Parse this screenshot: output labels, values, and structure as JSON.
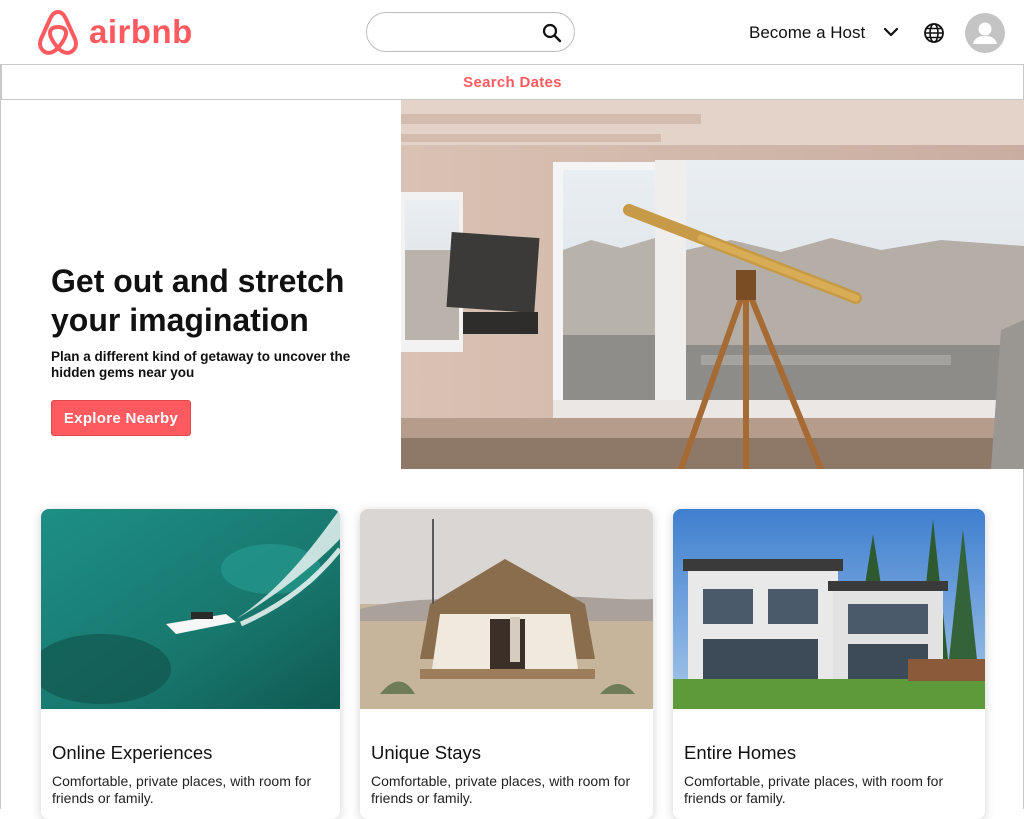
{
  "header": {
    "logo_text": "airbnb",
    "search": {
      "value": "",
      "placeholder": ""
    },
    "host_label": "Become a Host",
    "icons": [
      "search-icon",
      "chevron-down-icon",
      "globe-icon",
      "user-avatar-icon"
    ]
  },
  "dates_bar": {
    "label": "Search Dates"
  },
  "hero": {
    "title": "Get out and stretch your imagination",
    "subtitle": "Plan a different kind of getaway to uncover the hidden gems near you",
    "cta_label": "Explore Nearby"
  },
  "cards": [
    {
      "title": "Online Experiences",
      "description": "Comfortable, private places, with room for friends or family."
    },
    {
      "title": "Unique Stays",
      "description": "Comfortable, private places, with room for friends or family."
    },
    {
      "title": "Entire Homes",
      "description": "Comfortable, private places, with room for friends or family."
    }
  ],
  "colors": {
    "brand": "#ff5a5f",
    "text": "#111111",
    "border": "#c8c8c8"
  }
}
